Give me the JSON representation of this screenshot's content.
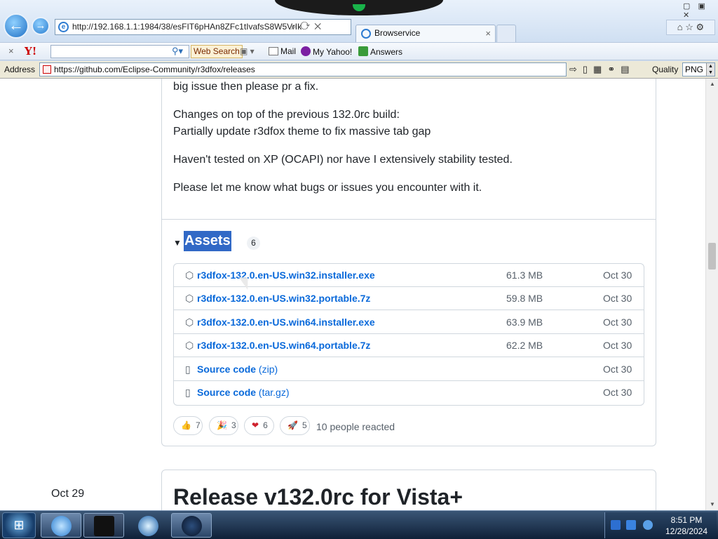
{
  "browser": {
    "back_icon": "back-arrow-icon",
    "forward_icon": "forward-arrow-icon",
    "url": "http://192.168.1.1:1984/38/esFIT6pHAn8ZFc1tIvafsS8W5VrIk",
    "tab_title": "Browservice",
    "tab_close": "×",
    "window_controls": "▢ ▣ ✕",
    "right_icons": "⌂ ☆ ⚙"
  },
  "yahoo_toolbar": {
    "close": "×",
    "logo": "Y!",
    "search_value": "",
    "web_search": "Web Search",
    "mail": "Mail",
    "my_yahoo": "My Yahoo!",
    "answers": "Answers"
  },
  "address_bar": {
    "label": "Address",
    "value": "https://github.com/Eclipse-Community/r3dfox/releases",
    "quality_label": "Quality",
    "quality_value": "PNG"
  },
  "release_notes": {
    "line1": "big issue then please pr a fix.",
    "line2a": "Changes on top of the previous 132.0rc build:",
    "line2b": "Partially update r3dfox theme to fix massive tab gap",
    "line3": "Haven't tested on XP (OCAPI) nor have I extensively stability tested.",
    "line4": "Please let me know what bugs or issues you encounter with it."
  },
  "assets": {
    "toggle": "▼",
    "title": "Assets",
    "count": "6",
    "items": [
      {
        "name": "r3dfox-132.0.en-US.win32.installer.exe",
        "paren": "",
        "size": "61.3 MB",
        "date": "Oct 30",
        "icon": "package-icon"
      },
      {
        "name": "r3dfox-132.0.en-US.win32.portable.7z",
        "paren": "",
        "size": "59.8 MB",
        "date": "Oct 30",
        "icon": "package-icon"
      },
      {
        "name": "r3dfox-132.0.en-US.win64.installer.exe",
        "paren": "",
        "size": "63.9 MB",
        "date": "Oct 30",
        "icon": "package-icon"
      },
      {
        "name": "r3dfox-132.0.en-US.win64.portable.7z",
        "paren": "",
        "size": "62.2 MB",
        "date": "Oct 30",
        "icon": "package-icon"
      },
      {
        "name": "Source code",
        "paren": "(zip)",
        "size": "",
        "date": "Oct 30",
        "icon": "file-zip-icon"
      },
      {
        "name": "Source code",
        "paren": "(tar.gz)",
        "size": "",
        "date": "Oct 30",
        "icon": "file-zip-icon"
      }
    ]
  },
  "reactions": {
    "items": [
      {
        "emoji": "👍",
        "count": "7",
        "icon": "thumbs-up-icon"
      },
      {
        "emoji": "🎉",
        "count": "3",
        "icon": "party-icon"
      },
      {
        "emoji": "❤",
        "count": "6",
        "icon": "heart-icon"
      },
      {
        "emoji": "🚀",
        "count": "5",
        "icon": "rocket-icon"
      }
    ],
    "summary": "10 people reacted"
  },
  "next_release": {
    "date": "Oct 29",
    "title": "Release v132.0rc for Vista+"
  },
  "taskbar": {
    "clock_time": "8:51 PM",
    "clock_date": "12/28/2024"
  },
  "colors": {
    "link": "#0969da",
    "selection": "#3169c6",
    "border": "#d0d7de"
  }
}
